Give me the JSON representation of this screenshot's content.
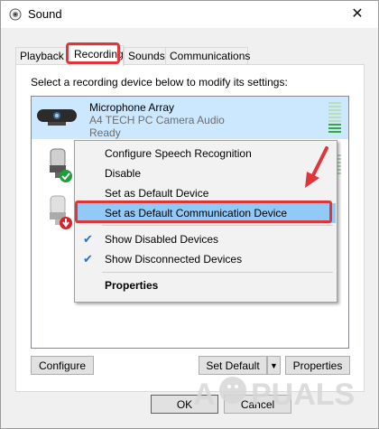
{
  "window": {
    "title": "Sound",
    "close_glyph": "✕"
  },
  "tabs": [
    {
      "label": "Playback",
      "active": false
    },
    {
      "label": "Recording",
      "active": true
    },
    {
      "label": "Sounds",
      "active": false
    },
    {
      "label": "Communications",
      "active": false
    }
  ],
  "instruction": "Select a recording device below to modify its settings:",
  "devices": [
    {
      "name": "Microphone Array",
      "sub1": "A4 TECH PC Camera Audio",
      "sub2": "Ready",
      "icon": "webcam-mic-icon"
    },
    {
      "icon": "microphone-default-icon",
      "status": "default-check"
    },
    {
      "icon": "microphone-disabled-icon",
      "status": "disabled-arrow"
    }
  ],
  "context_menu": {
    "items": [
      {
        "label": "Configure Speech Recognition"
      },
      {
        "label": "Disable"
      },
      {
        "label": "Set as Default Device"
      },
      {
        "label": "Set as Default Communication Device",
        "hover": true
      },
      {
        "label": "Show Disabled Devices",
        "checked": true
      },
      {
        "label": "Show Disconnected Devices",
        "checked": true
      },
      {
        "label": "Properties",
        "bold": true
      }
    ],
    "check_glyph": "✔"
  },
  "buttons": {
    "configure": "Configure",
    "set_default": "Set Default",
    "dropdown_glyph": "▼",
    "properties": "Properties",
    "ok": "OK",
    "cancel": "Cancel"
  },
  "watermark": {
    "text": "APPUALS"
  },
  "colors": {
    "highlight_red": "#e0363a",
    "selection_blue": "#cce8ff",
    "menu_hover": "#91c9f7",
    "meter_green": "#37a843"
  }
}
